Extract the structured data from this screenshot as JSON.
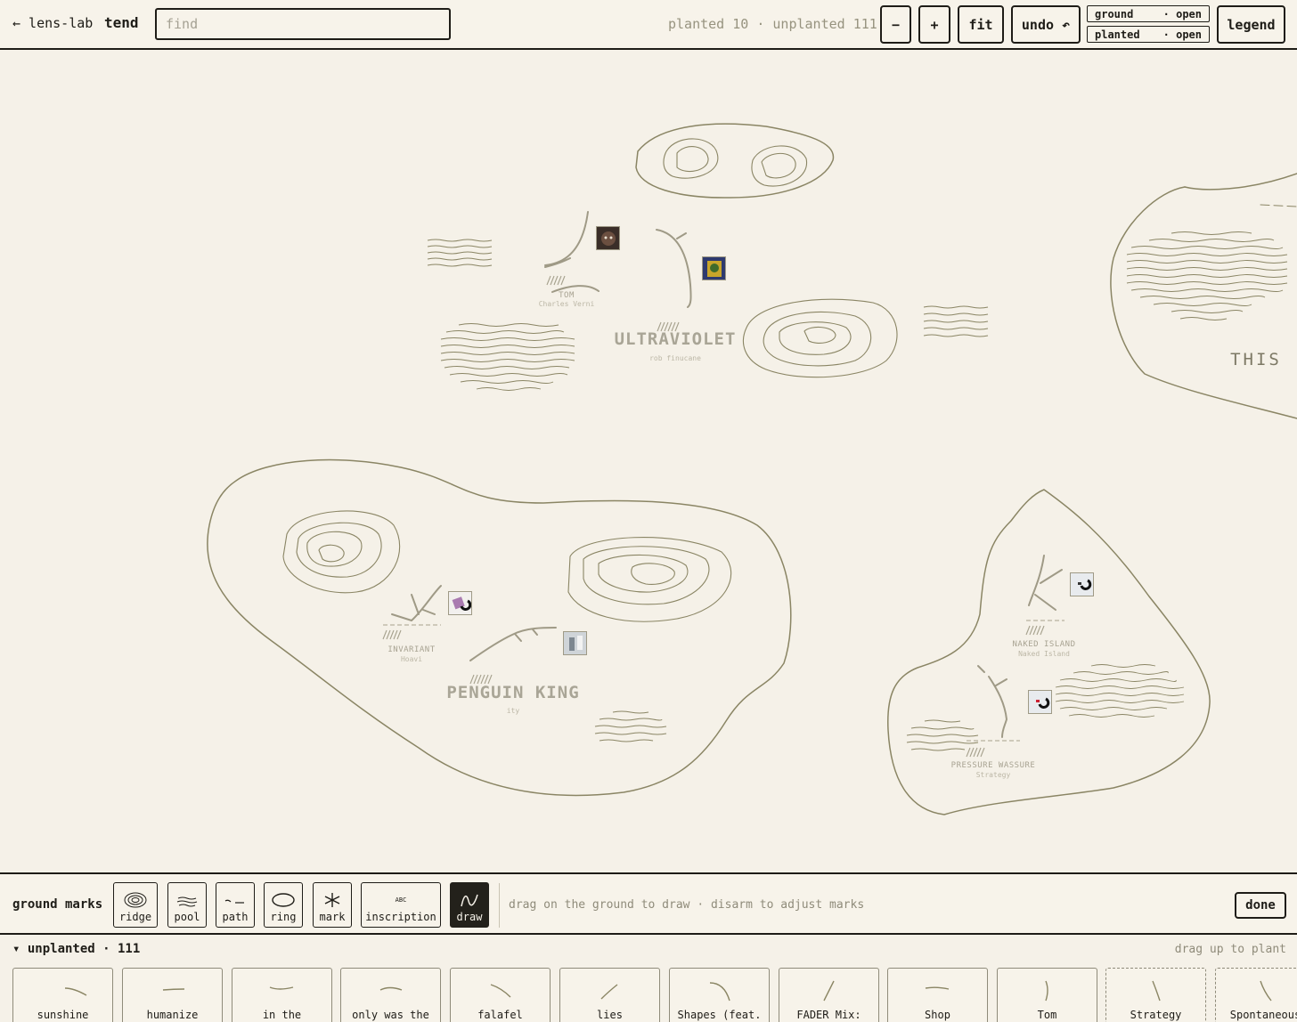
{
  "topbar": {
    "back_label": "← lens-lab",
    "app_title": "tend",
    "search_placeholder": "find",
    "counts": "planted 10 · unplanted 111",
    "zoom_out": "−",
    "zoom_in": "+",
    "fit": "fit",
    "undo": "undo ↶",
    "layers": [
      {
        "name": "ground",
        "state": "· open"
      },
      {
        "name": "planted",
        "state": "· open"
      }
    ],
    "legend": "legend"
  },
  "map": {
    "labels": {
      "tom": "TOM",
      "tom_sub": "Charles Verni",
      "ultraviolet": "ULTRAVIOLET",
      "ultraviolet_sub": "rob finucane",
      "this": "THIS",
      "invariant": "INVARIANT",
      "invariant_sub": "Hoavi",
      "penguin_king": "PENGUIN KING",
      "penguin_sub": "ity",
      "naked_island": "NAKED ISLAND",
      "naked_island_sub": "Naked Island",
      "pressure": "PRESSURE WASSURE",
      "pressure_sub": "Strategy"
    }
  },
  "marks": {
    "title": "ground marks",
    "tools": [
      "ridge",
      "pool",
      "path",
      "ring",
      "mark",
      "inscription",
      "draw"
    ],
    "active_tool": "draw",
    "inscription_glyph": "ABC",
    "hint": "drag on the ground to draw · disarm to adjust marks",
    "done": "done"
  },
  "tray": {
    "title": "▾ unplanted · 111",
    "hint": "drag up to plant",
    "cards": [
      "sunshine",
      "humanize",
      "in the",
      "only was the",
      "falafel",
      "lies",
      "Shapes (feat.",
      "FADER Mix:",
      "Shop",
      "Tom",
      "Strategy",
      "Spontaneous"
    ]
  },
  "colors": {
    "background": "#f5f1e8",
    "ink": "#1e1c17",
    "ground_line": "#8a8564",
    "muted": "#a8a392"
  }
}
